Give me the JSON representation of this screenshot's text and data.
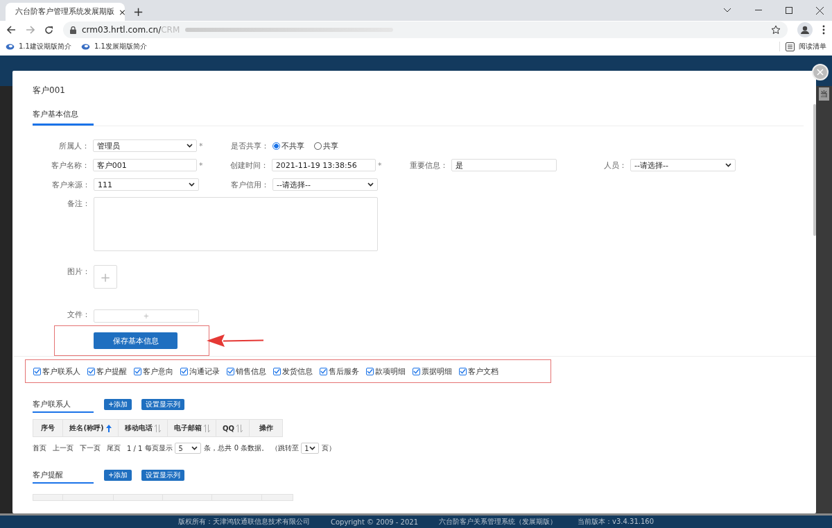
{
  "browser": {
    "tab_title": "六台阶客户管理系统发展期版",
    "tab_close": "×",
    "new_tab": "+",
    "address": "crm03.hrtl.com.cn/",
    "address_faded": "CRM",
    "bookmarks": [
      "1.1建设期版简介",
      "1.1发展期版简介"
    ],
    "reading_list": "阅读清单"
  },
  "app_header": {
    "side_text": "当"
  },
  "modal": {
    "title": "客户001",
    "close": "×",
    "required_mark": "*",
    "section_tab": "客户基本信息",
    "rows": [
      [
        {
          "label": "所属人：",
          "kind": "select",
          "value": "管理员",
          "required": true
        },
        {
          "label": "是否共享：",
          "kind": "radio",
          "options": [
            {
              "label": "不共享",
              "selected": true
            },
            {
              "label": "共享",
              "selected": false
            }
          ]
        }
      ],
      [
        {
          "label": "客户名称：",
          "kind": "text",
          "value": "客户001",
          "required": true
        },
        {
          "label": "创建时间：",
          "kind": "text",
          "value": "2021-11-19 13:38:56",
          "required": true
        },
        {
          "label": "重要信息：",
          "kind": "text",
          "value": "是"
        },
        {
          "label": "人员：",
          "kind": "select",
          "value": "--请选择--"
        }
      ],
      [
        {
          "label": "客户来源：",
          "kind": "select",
          "value": "111"
        },
        {
          "label": "客户信用：",
          "kind": "select",
          "value": "--请选择--"
        }
      ]
    ],
    "remark_label": "备注：",
    "image_label": "图片：",
    "image_add": "+",
    "file_label": "文件：",
    "file_add": "+",
    "save_button": "保存基本信息",
    "modules": [
      {
        "label": "客户联系人",
        "checked": true
      },
      {
        "label": "客户提醒",
        "checked": true
      },
      {
        "label": "客户意向",
        "checked": true
      },
      {
        "label": "沟通记录",
        "checked": true
      },
      {
        "label": "销售信息",
        "checked": true
      },
      {
        "label": "发货信息",
        "checked": true
      },
      {
        "label": "售后服务",
        "checked": true
      },
      {
        "label": "款项明细",
        "checked": true
      },
      {
        "label": "票据明细",
        "checked": true
      },
      {
        "label": "客户文档",
        "checked": true
      }
    ],
    "sections": [
      {
        "title": "客户联系人",
        "add": "+添加",
        "columns_button": "设置显示列",
        "table": {
          "columns": [
            {
              "label": "序号",
              "sortable": false
            },
            {
              "label": "姓名(称呼)",
              "sortable": true,
              "sorted": true
            },
            {
              "label": "移动电话",
              "sortable": true,
              "sorted": false
            },
            {
              "label": "电子邮箱",
              "sortable": true,
              "sorted": false
            },
            {
              "label": "QQ",
              "sortable": true,
              "sorted": false
            },
            {
              "label": "操作",
              "sortable": false
            }
          ]
        },
        "pager": {
          "links": [
            "首页",
            "上一页",
            "下一页",
            "尾页"
          ],
          "pages": "1 / 1",
          "per_page_label": "每页显示",
          "per_page": "5",
          "summary": "条，总共 0 条数据。",
          "jump_label": "（跳转至",
          "jump": "1",
          "jump_end": "页）"
        }
      },
      {
        "title": "客户提醒",
        "add": "+添加",
        "columns_button": "设置显示列"
      }
    ]
  },
  "footer": [
    "版权所有：天津鸿软通联信息技术有限公司",
    "Copyright © 2009 - 2021",
    "六台阶客户关系管理系统（发展期版）",
    "当前版本：v3.4.31.160"
  ]
}
